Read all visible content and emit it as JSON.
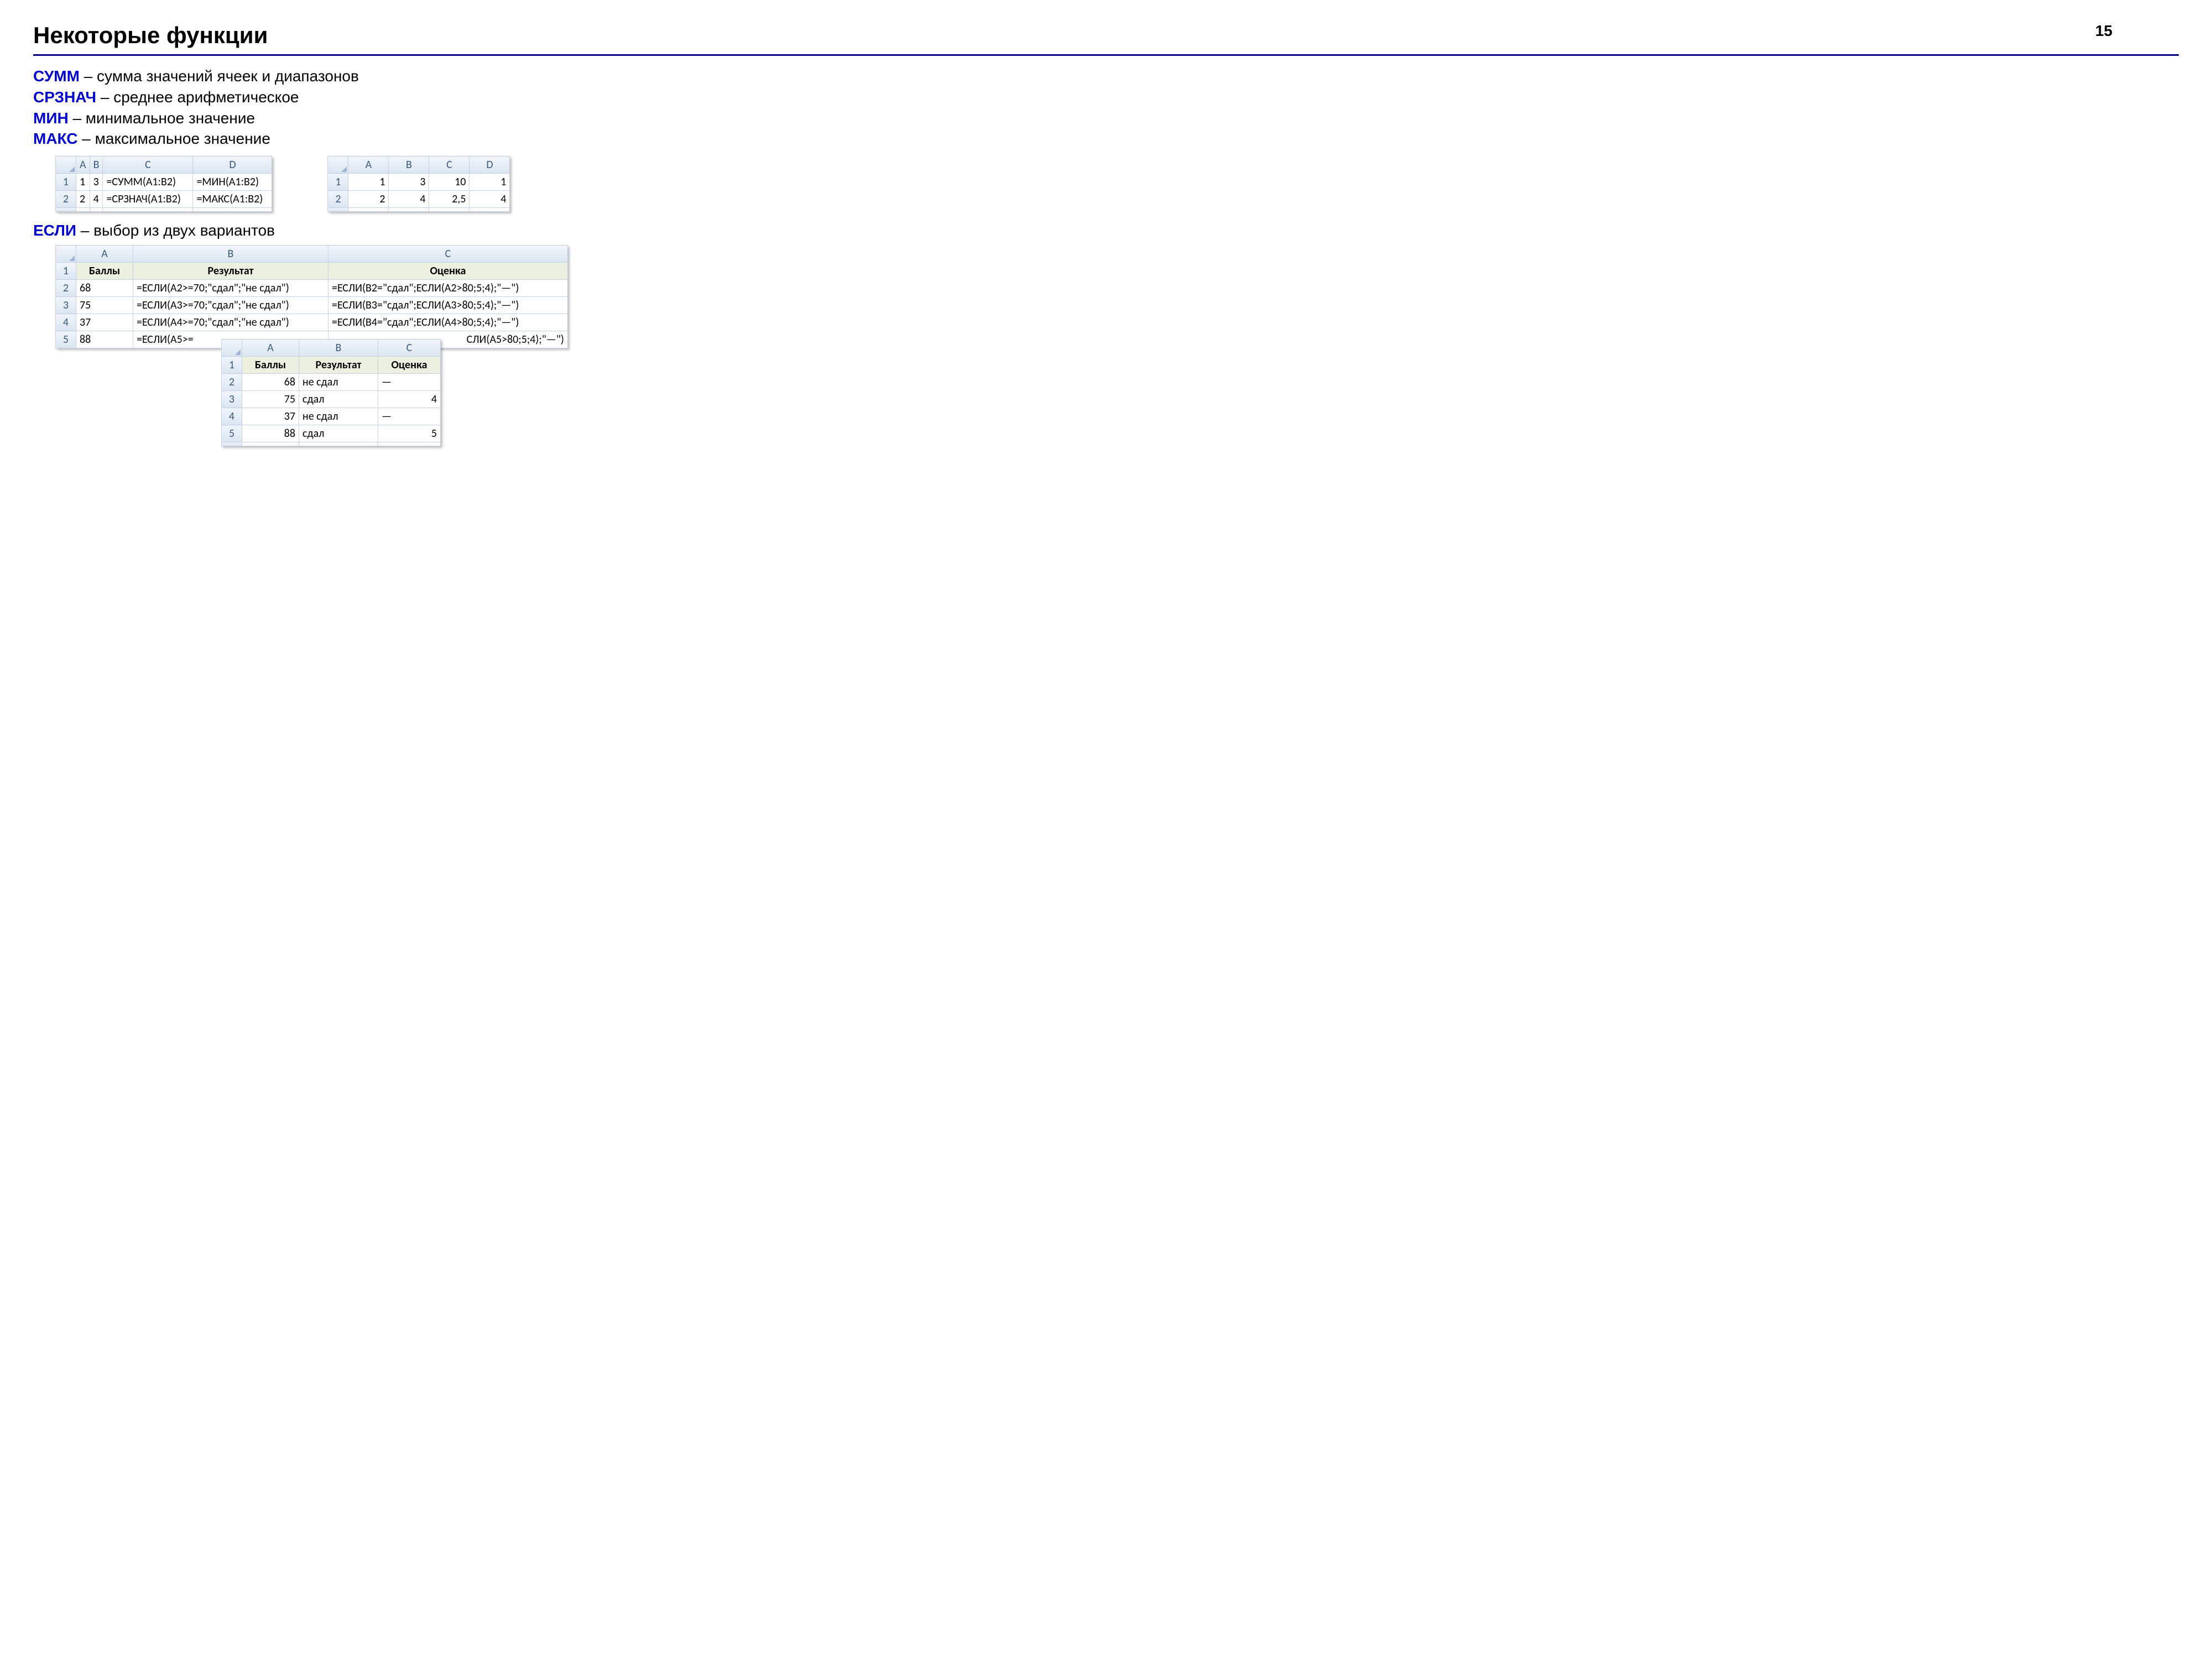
{
  "page_number": "15",
  "title": "Некоторые функции",
  "definitions": [
    {
      "func": "СУММ",
      "desc": " – сумма значений ячеек и диапазонов"
    },
    {
      "func": "СРЗНАЧ",
      "desc": " – среднее арифметическое"
    },
    {
      "func": "МИН",
      "desc": " – минимальное значение"
    },
    {
      "func": "МАКС",
      "desc": " – максимальное значение"
    }
  ],
  "table1": {
    "cols": [
      "A",
      "B",
      "C",
      "D"
    ],
    "rows": [
      {
        "n": "1",
        "a": "1",
        "b": "3",
        "c": "=СУММ(A1:B2)",
        "d": "=МИН(A1:B2)"
      },
      {
        "n": "2",
        "a": "2",
        "b": "4",
        "c": "=СРЗНАЧ(A1:B2)",
        "d": "=МАКС(A1:B2)"
      }
    ]
  },
  "table2": {
    "cols": [
      "A",
      "B",
      "C",
      "D"
    ],
    "rows": [
      {
        "n": "1",
        "a": "1",
        "b": "3",
        "c": "10",
        "d": "1"
      },
      {
        "n": "2",
        "a": "2",
        "b": "4",
        "c": "2,5",
        "d": "4"
      }
    ]
  },
  "subhead": {
    "func": "ЕСЛИ",
    "desc": " – выбор из двух вариантов"
  },
  "table3": {
    "cols": [
      "A",
      "B",
      "C"
    ],
    "header_row": {
      "n": "1",
      "a": "Баллы",
      "b": "Результат",
      "c": "Оценка"
    },
    "rows": [
      {
        "n": "2",
        "a": "68",
        "b": "=ЕСЛИ(A2>=70;\"сдал\";\"не сдал\")",
        "c": "=ЕСЛИ(B2=\"сдал\";ЕСЛИ(A2>80;5;4);\"—\")"
      },
      {
        "n": "3",
        "a": "75",
        "b": "=ЕСЛИ(A3>=70;\"сдал\";\"не сдал\")",
        "c": "=ЕСЛИ(B3=\"сдал\";ЕСЛИ(A3>80;5;4);\"—\")"
      },
      {
        "n": "4",
        "a": "37",
        "b": "=ЕСЛИ(A4>=70;\"сдал\";\"не сдал\")",
        "c": "=ЕСЛИ(B4=\"сдал\";ЕСЛИ(A4>80;5;4);\"—\")"
      },
      {
        "n": "5",
        "a": "88",
        "b": "=ЕСЛИ(A5>=",
        "c": "СЛИ(A5>80;5;4);\"—\")"
      }
    ]
  },
  "table4": {
    "cols": [
      "A",
      "B",
      "C"
    ],
    "header_row": {
      "n": "1",
      "a": "Баллы",
      "b": "Результат",
      "c": "Оценка"
    },
    "rows": [
      {
        "n": "2",
        "a": "68",
        "b": "не сдал",
        "c": "—"
      },
      {
        "n": "3",
        "a": "75",
        "b": "сдал",
        "c": "4"
      },
      {
        "n": "4",
        "a": "37",
        "b": "не сдал",
        "c": "—"
      },
      {
        "n": "5",
        "a": "88",
        "b": "сдал",
        "c": "5"
      }
    ]
  }
}
